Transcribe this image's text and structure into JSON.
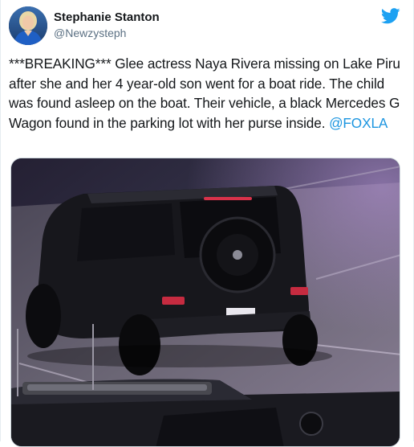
{
  "author": {
    "display_name": "Stephanie Stanton",
    "handle": "@Newzysteph"
  },
  "tweet": {
    "text_before_mention": "***BREAKING*** Glee actress Naya Rivera missing on Lake Piru after she and her 4 year-old son went for a boat ride. The child was found asleep on the boat. Their vehicle, a black Mercedes G Wagon found in the parking lot with her purse inside. ",
    "mention": "@FOXLA"
  },
  "icons": {
    "brand": "twitter-bird-icon"
  },
  "colors": {
    "twitter_blue": "#1da1f2",
    "mention_link": "#1b95e0",
    "handle_gray": "#5b7083"
  }
}
